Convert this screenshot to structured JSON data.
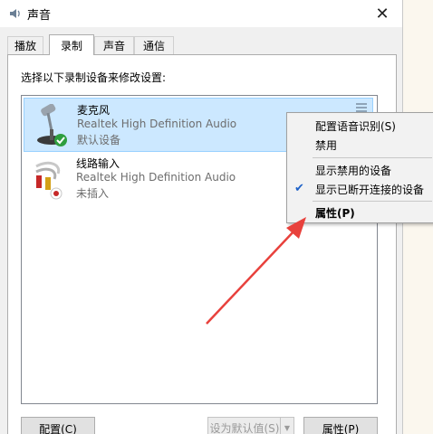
{
  "window": {
    "title": "声音",
    "close_glyph": "✕"
  },
  "tabs": [
    {
      "label": "播放"
    },
    {
      "label": "录制"
    },
    {
      "label": "声音"
    },
    {
      "label": "通信"
    }
  ],
  "instruction": "选择以下录制设备来修改设置:",
  "devices": [
    {
      "name": "麦克风",
      "description": "Realtek High Definition Audio",
      "status": "默认设备",
      "icon": "microphone-icon",
      "badge": "green-check-icon",
      "selected": true
    },
    {
      "name": "线路输入",
      "description": "Realtek High Definition Audio",
      "status": "未插入",
      "icon": "line-in-cable-icon",
      "badge": "red-unplugged-icon",
      "selected": false
    }
  ],
  "buttons": {
    "configure": "配置(C)",
    "set_default": "设为默认值(S)",
    "properties": "属性(P)"
  },
  "context_menu": {
    "items": [
      {
        "label": "配置语音识别(S)"
      },
      {
        "label": "禁用"
      },
      {
        "label": "显示禁用的设备"
      },
      {
        "label": "显示已断开连接的设备",
        "checked": true
      },
      {
        "label": "属性(P)",
        "bold": true
      }
    ]
  },
  "colors": {
    "selection": "#cce8ff",
    "annotation_arrow": "#e8413c",
    "check": "#1e62c8"
  }
}
